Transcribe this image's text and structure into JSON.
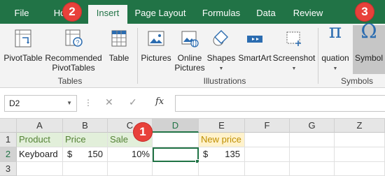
{
  "menubar": {
    "tabs": [
      "File",
      "Ho",
      "Insert",
      "Page Layout",
      "Formulas",
      "Data",
      "Review"
    ],
    "badges": [
      "2",
      "3"
    ]
  },
  "ribbon": {
    "tables": {
      "pivot_table": "PivotTable",
      "recommended_1": "Recommended",
      "recommended_2": "PivotTables",
      "table": "Table",
      "group": "Tables"
    },
    "illustrations": {
      "pictures": "Pictures",
      "online_1": "Online",
      "online_2": "Pictures",
      "shapes": "Shapes",
      "smartart": "SmartArt",
      "screenshot": "Screenshot",
      "group": "Illustrations"
    },
    "symbols": {
      "equation": "quation",
      "symbol": "Symbol",
      "group": "Symbols"
    }
  },
  "formula_bar": {
    "name_box": "D2",
    "fx": "fx",
    "formula": ""
  },
  "grid": {
    "columns": [
      "A",
      "B",
      "C",
      "D",
      "E",
      "F",
      "G",
      "Z"
    ],
    "rows": [
      "1",
      "2",
      "3"
    ],
    "A1": "Product",
    "B1": "Price",
    "C1": "Sale",
    "E1": "New price",
    "A2": "Keyboard",
    "B2_sym": "$",
    "B2_val": "150",
    "C2": "10%",
    "E2_sym": "$",
    "E2_val": "135",
    "badge_1": "1"
  },
  "colors": {
    "excel_green": "#217346",
    "badge_red": "#e8413a",
    "green_fill": "#e2efda",
    "yellow_fill": "#fff2cc"
  }
}
